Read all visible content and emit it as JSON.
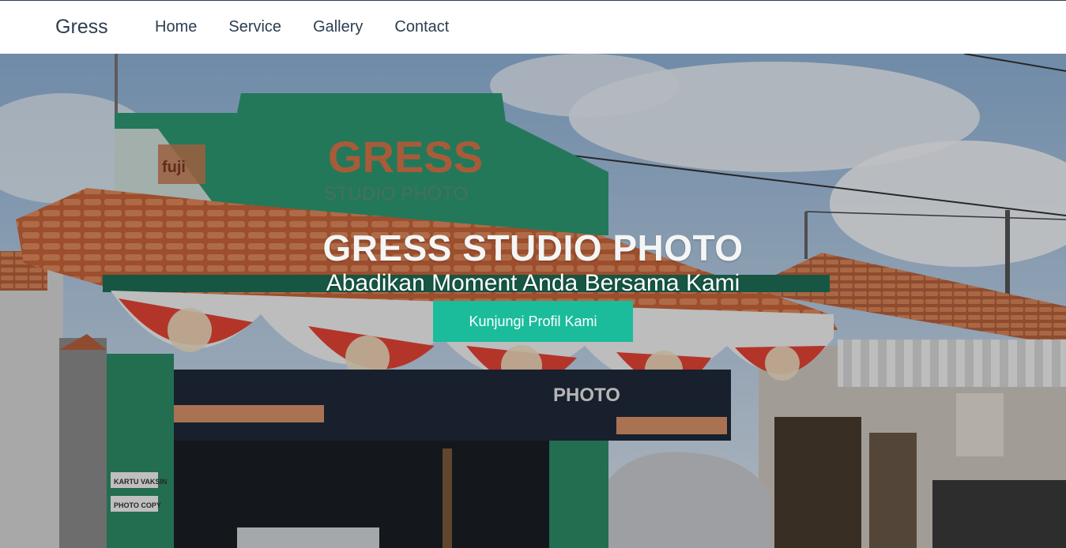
{
  "navbar": {
    "brand": "Gress",
    "links": [
      {
        "label": "Home"
      },
      {
        "label": "Service"
      },
      {
        "label": "Gallery"
      },
      {
        "label": "Contact"
      }
    ]
  },
  "hero": {
    "title": "GRESS STUDIO PHOTO",
    "subtitle": "Abadikan Moment Anda Bersama Kami",
    "button_label": "Kunjungi Profil Kami",
    "photo_signage": {
      "sign_main": "GRESS",
      "sign_sub": "STUDIO PHOTO",
      "logo": "fuji",
      "board_text": "PHOTO",
      "poster_1": "KARTU VAKSIN",
      "poster_2": "PHOTO COPY"
    }
  },
  "colors": {
    "accent": "#1abc9c",
    "nav_text": "#2c3e50",
    "hero_text": "#ffffff"
  }
}
